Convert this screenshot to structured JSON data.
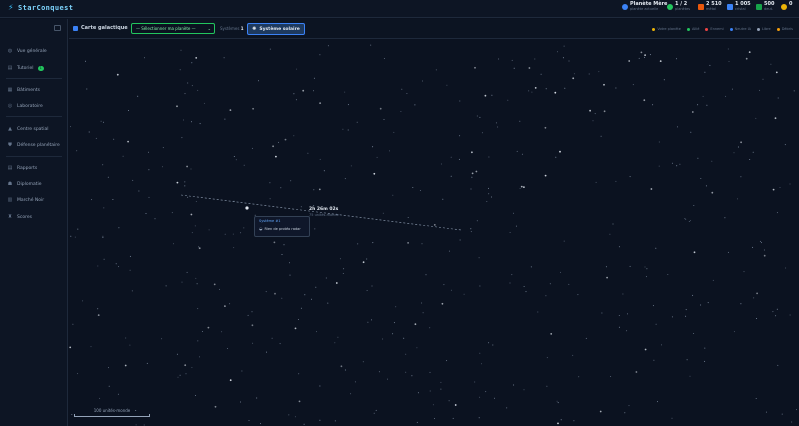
{
  "app": {
    "name": "StarConquest"
  },
  "resources": [
    {
      "key": "planet",
      "value": "Planète Mère",
      "label": "planète actuelle",
      "color": "#3b82f6",
      "icon": "planet-icon"
    },
    {
      "key": "planets",
      "value": "1 / 2",
      "label": "planètes",
      "color": "#22c55e",
      "icon": "globe-icon"
    },
    {
      "key": "metal",
      "value": "2 510",
      "label": "métal",
      "color": "#ea580c",
      "icon": "metal-icon"
    },
    {
      "key": "crystal",
      "value": "1 005",
      "label": "cristal",
      "color": "#3b82f6",
      "icon": "crystal-icon"
    },
    {
      "key": "deuterium",
      "value": "500",
      "label": "deut.",
      "color": "#16a34a",
      "icon": "deuterium-icon"
    },
    {
      "key": "energy",
      "value": "0",
      "label": "",
      "color": "#eab308",
      "icon": "energy-icon"
    }
  ],
  "sidebar": {
    "items": [
      {
        "label": "Vue générale",
        "icon": "globe-icon"
      },
      {
        "label": "Tutoriel",
        "icon": "book-icon",
        "badge": "1"
      },
      {
        "label": "Bâtiments",
        "icon": "building-icon"
      },
      {
        "label": "Laboratoire",
        "icon": "flask-icon"
      },
      {
        "label": "Centre spatial",
        "icon": "rocket-icon"
      },
      {
        "label": "Défense planétaire",
        "icon": "shield-icon"
      },
      {
        "label": "Rapports",
        "icon": "report-icon"
      },
      {
        "label": "Diplomatie",
        "icon": "people-icon"
      },
      {
        "label": "Marché Noir",
        "icon": "market-icon"
      },
      {
        "label": "Scores",
        "icon": "trophy-icon"
      }
    ]
  },
  "map_header": {
    "title": "Carte galactique",
    "planet_select": "— Sélectionner ma planète —",
    "systems_label": "Systèmes",
    "systems_count": "1",
    "solar_button": "Système solaire",
    "legend": [
      {
        "label": "Votre planète",
        "color": "#eab308"
      },
      {
        "label": "Allié",
        "color": "#22c55e"
      },
      {
        "label": "Ennemi",
        "color": "#ef4444"
      },
      {
        "label": "Neutre IA",
        "color": "#3b82f6"
      },
      {
        "label": "Libre",
        "color": "#94a3b8"
      },
      {
        "label": "Débris",
        "color": "#f59e0b"
      }
    ]
  },
  "map": {
    "route": {
      "time": "2h 26m 02s",
      "distance": "75 unités-monde"
    },
    "tooltip": {
      "name": "Système #1",
      "content": "Rien de protéo radar"
    },
    "scale_label": "100 unités-monde"
  }
}
